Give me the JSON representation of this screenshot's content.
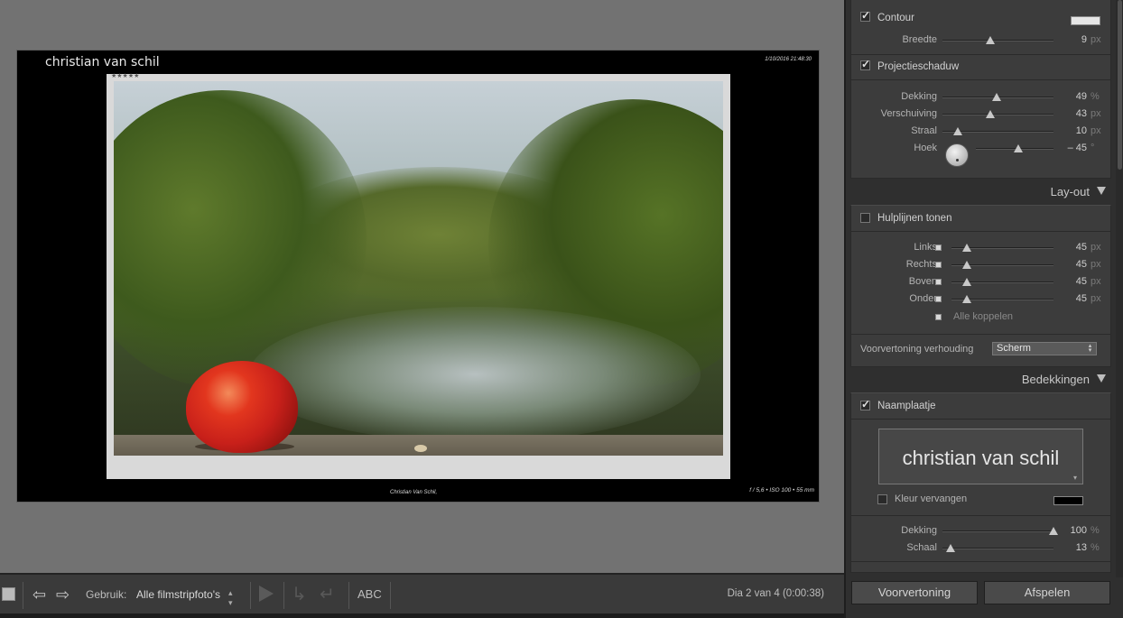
{
  "slide": {
    "identity": "christian van schil",
    "datetime": "1/10/2016 21:48:30",
    "rating": "★★★★★",
    "caption": "Christian Van Schil,",
    "exif": "f / 5,6 • ISO 100 • 55 mm"
  },
  "toolbar": {
    "use_label": "Gebruik:",
    "use_value": "Alle filmstripfoto's",
    "abc_label": "ABC",
    "status": "Dia 2 van 4 (0:00:38)"
  },
  "panel": {
    "contour": {
      "label": "Contour",
      "checked": true,
      "color": "#e6e6e6",
      "width_label": "Breedte",
      "width_value": "9",
      "width_unit": "px",
      "width_fraction": 0.43
    },
    "shadow": {
      "label": "Projectieschaduw",
      "checked": true,
      "sliders": [
        {
          "label": "Dekking",
          "value": "49",
          "unit": "%",
          "fraction": 0.49
        },
        {
          "label": "Verschuiving",
          "value": "43",
          "unit": "px",
          "fraction": 0.43
        },
        {
          "label": "Straal",
          "value": "10",
          "unit": "px",
          "fraction": 0.14
        },
        {
          "label": "Hoek",
          "value": "– 45",
          "unit": "°",
          "fraction": 0.55
        }
      ]
    },
    "layout": {
      "header": "Lay-out",
      "guides_label": "Hulplijnen tonen",
      "guides_checked": false,
      "margins": [
        {
          "label": "Links",
          "value": "45",
          "unit": "px",
          "fraction": 0.15
        },
        {
          "label": "Rechts",
          "value": "45",
          "unit": "px",
          "fraction": 0.15
        },
        {
          "label": "Boven",
          "value": "45",
          "unit": "px",
          "fraction": 0.15
        },
        {
          "label": "Onder",
          "value": "45",
          "unit": "px",
          "fraction": 0.15
        }
      ],
      "link_all_label": "Alle koppelen",
      "preview_ratio_label": "Voorvertoning verhouding",
      "preview_ratio_value": "Scherm"
    },
    "overlays": {
      "header": "Bedekkingen",
      "identity_plate_label": "Naamplaatje",
      "identity_plate_checked": true,
      "identity_plate_text": "christian van schil",
      "override_color_label": "Kleur vervangen",
      "override_color_checked": false,
      "override_color": "#000000",
      "sliders": [
        {
          "label": "Dekking",
          "value": "100",
          "unit": "%",
          "fraction": 1.0
        },
        {
          "label": "Schaal",
          "value": "13",
          "unit": "%",
          "fraction": 0.07
        }
      ]
    },
    "preview_button": "Voorvertoning",
    "play_button": "Afspelen"
  }
}
